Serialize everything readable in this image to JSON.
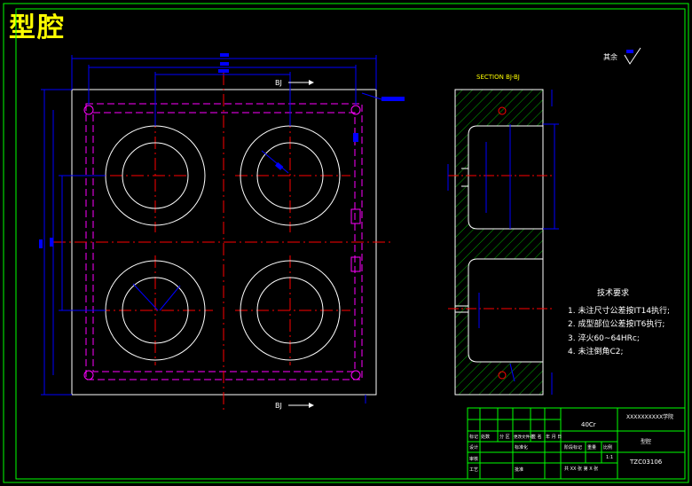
{
  "title": "型腔",
  "section_label": "SECTION BJ-BJ",
  "section_mark_top": "BJ",
  "section_mark_bottom": "BJ",
  "roughness_label": "其余",
  "tech_requirements": {
    "heading": "技术要求",
    "items": [
      "1. 未注尺寸公差按IT14执行;",
      "2. 成型部位公差按IT6执行;",
      "3. 淬火60~64HRc;",
      "4. 未注倒角C2;"
    ]
  },
  "title_block": {
    "material": "40Cr",
    "school": "XXXXXXXXXX学院",
    "part_name": "型腔",
    "drawing_no": "TZC03106",
    "scale": "1:1",
    "sheet": "共 XX 张 第 X 张",
    "row_labels": [
      "标记",
      "处数",
      "分 区",
      "更改文件号",
      "签 名",
      "年 月 日"
    ],
    "design_label": "设计",
    "standard_label": "标准化",
    "review_label": "审核",
    "process_label": "工艺",
    "approve_label": "批准",
    "stage_label": "阶段标记",
    "weight_label": "重量",
    "scale_label": "比例"
  },
  "colors": {
    "outline": "#ffffff",
    "frame": "#00ff00",
    "centerline": "#ff0000",
    "hidden": "#ff00ff",
    "dimension": "#0000ff",
    "hatch": "#00cc00",
    "title": "#ffff00"
  }
}
